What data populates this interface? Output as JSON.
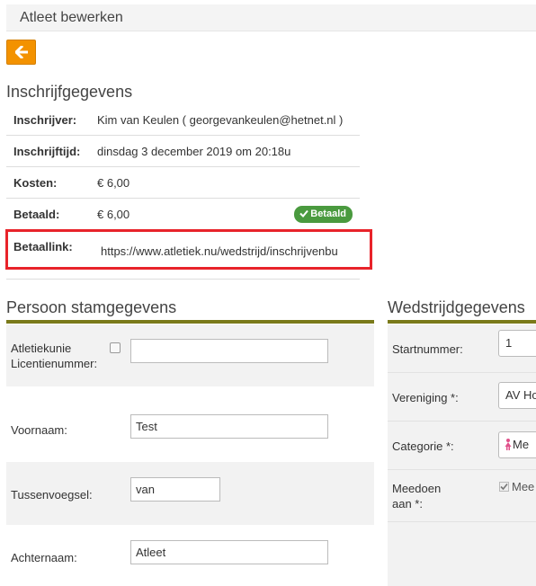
{
  "header": {
    "title": "Atleet bewerken"
  },
  "back_button": {
    "icon": "arrow-left-icon"
  },
  "registration": {
    "title": "Inschrijfgegevens",
    "rows": [
      {
        "label": "Inschrijver:",
        "value": "Kim van Keulen ( georgevankeulen@hetnet.nl )"
      },
      {
        "label": "Inschrijftijd:",
        "value": "dinsdag 3 december 2019 om 20:18u"
      },
      {
        "label": "Kosten:",
        "value": "€ 6,00"
      },
      {
        "label": "Betaald:",
        "value": "€ 6,00"
      }
    ],
    "paid_badge": "Betaald",
    "payment_link": {
      "label": "Betaallink:",
      "value": "https://www.atletiek.nu/wedstrijd/inschrijvenbu"
    }
  },
  "person": {
    "title": "Persoon stamgegevens",
    "licence_label": "Atletiekunie Licentienummer:",
    "licence_label_line1": "Atletiekunie",
    "licence_label_line2": "Licentienummer:",
    "licence_value": "",
    "first_name_label": "Voornaam:",
    "first_name_value": "Test",
    "infix_label": "Tussenvoegsel:",
    "infix_value": "van",
    "last_name_label": "Achternaam:",
    "last_name_value": "Atleet"
  },
  "competition": {
    "title": "Wedstrijdgegevens",
    "start_number_label": "Startnummer:",
    "start_number_value": "1",
    "club_label": "Vereniging *:",
    "club_value": "AV Ho",
    "category_label": "Categorie *:",
    "category_value": "Me",
    "participate_label_line1": "Meedoen",
    "participate_label_line2": "aan *:",
    "participate_value": "Mee"
  },
  "colors": {
    "accent": "#f39200",
    "highlight": "#e8232a",
    "badge": "#4a9a3f",
    "panel_line": "#7a7a1a"
  }
}
